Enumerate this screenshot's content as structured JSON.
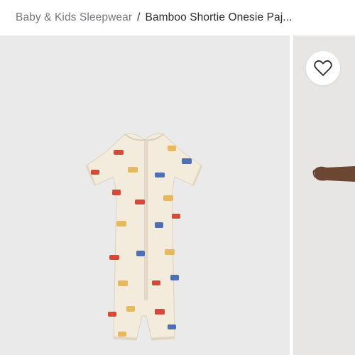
{
  "breadcrumb": {
    "parent": "Baby & Kids Sleepwear",
    "separator": "/",
    "current": "Bamboo Shortie Onesie Paj..."
  },
  "gallery": {
    "favorite_icon": "heart-outline-icon",
    "main_image": "cream onesie with car print",
    "next_image": "child arm"
  },
  "colors": {
    "image_bg": "#eaeaea",
    "garment": "#f3ecdd",
    "print_red": "#d8483a",
    "print_yellow": "#e7b95c",
    "print_blue": "#4d6fb5"
  }
}
